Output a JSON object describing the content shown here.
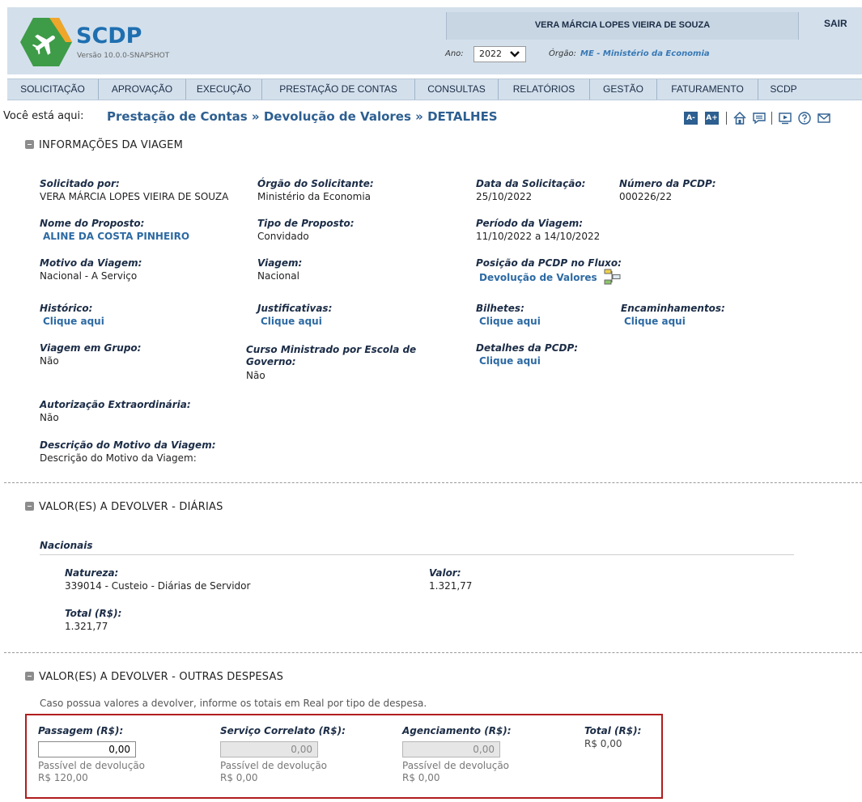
{
  "header": {
    "brand": "SCDP",
    "version": "Versão 10.0.0-SNAPSHOT",
    "user_name": "VERA MÁRCIA LOPES VIEIRA DE SOUZA",
    "logout_label": "SAIR",
    "ano_label": "Ano:",
    "ano_value": "2022",
    "orgao_label": "Órgão:",
    "orgao_value": "ME - Ministério da Economia"
  },
  "nav": {
    "items": [
      {
        "label": "SOLICITAÇÃO"
      },
      {
        "label": "APROVAÇÃO"
      },
      {
        "label": "EXECUÇÃO"
      },
      {
        "label": "PRESTAÇÃO DE CONTAS"
      },
      {
        "label": "CONSULTAS"
      },
      {
        "label": "RELATÓRIOS"
      },
      {
        "label": "GESTÃO"
      },
      {
        "label": "FATURAMENTO"
      },
      {
        "label": "SCDP"
      }
    ]
  },
  "breadcrumb": {
    "label": "Você está aqui:",
    "part1": "Prestação de Contas",
    "part2": "Devolução de Valores",
    "part3": "DETALHES",
    "separator": "»"
  },
  "tools": {
    "decrease_font": "A-",
    "increase_font": "A+"
  },
  "viagem": {
    "title": "INFORMAÇÕES DA VIAGEM",
    "solicitado_por_label": "Solicitado por:",
    "solicitado_por_value": "VERA MÁRCIA LOPES VIEIRA DE SOUZA",
    "orgao_solicitante_label": "Órgão do Solicitante:",
    "orgao_solicitante_value": "Ministério da Economia",
    "data_solicitacao_label": "Data da Solicitação:",
    "data_solicitacao_value": "25/10/2022",
    "numero_pcdp_label": "Número da PCDP:",
    "numero_pcdp_value": "000226/22",
    "nome_proposto_label": "Nome do Proposto:",
    "nome_proposto_value": "ALINE DA COSTA PINHEIRO",
    "tipo_proposto_label": "Tipo de Proposto:",
    "tipo_proposto_value": "Convidado",
    "periodo_label": "Período da Viagem:",
    "periodo_value": "11/10/2022 a 14/10/2022",
    "motivo_label": "Motivo da Viagem:",
    "motivo_value": "Nacional - A Serviço",
    "viagem_label": "Viagem:",
    "viagem_value": "Nacional",
    "posicao_label": "Posição da PCDP no Fluxo:",
    "posicao_value": "Devolução de Valores",
    "historico_label": "Histórico:",
    "historico_link": "Clique aqui",
    "justificativas_label": "Justificativas:",
    "justificativas_link": "Clique aqui",
    "bilhetes_label": "Bilhetes:",
    "bilhetes_link": "Clique aqui",
    "encaminhamentos_label": "Encaminhamentos:",
    "encaminhamentos_link": "Clique aqui",
    "grupo_label": "Viagem em Grupo:",
    "grupo_value": "Não",
    "curso_label": "Curso Ministrado por Escola de Governo:",
    "curso_value": "Não",
    "detalhes_label": "Detalhes da PCDP:",
    "detalhes_link": "Clique aqui",
    "autorizacao_label": "Autorização Extraordinária:",
    "autorizacao_value": "Não",
    "descricao_label": "Descrição do Motivo da Viagem:",
    "descricao_value": "Descrição do Motivo da Viagem:"
  },
  "diarias": {
    "title": "VALOR(ES) A DEVOLVER - DIÁRIAS",
    "subtitle": "Nacionais",
    "natureza_label": "Natureza:",
    "natureza_value": "339014 - Custeio - Diárias de Servidor",
    "valor_label": "Valor:",
    "valor_value": "1.321,77",
    "total_label": "Total (R$):",
    "total_value": "1.321,77"
  },
  "outras": {
    "title": "VALOR(ES) A DEVOLVER - OUTRAS DESPESAS",
    "instructions": "Caso possua valores a devolver, informe os totais em Real por tipo de despesa.",
    "passagem_label": "Passagem (R$):",
    "passagem_value": "0,00",
    "passagem_passivel": "Passível de devolução",
    "passagem_passivel_value": "R$ 120,00",
    "servico_label": "Serviço Correlato (R$):",
    "servico_value": "0,00",
    "servico_passivel": "Passível de devolução",
    "servico_passivel_value": "R$ 0,00",
    "agenciamento_label": "Agenciamento (R$):",
    "agenciamento_value": "0,00",
    "agenciamento_passivel": "Passível de devolução",
    "agenciamento_passivel_value": "R$ 0,00",
    "total_label": "Total (R$):",
    "total_value": "R$ 0,00"
  },
  "colors": {
    "header_bg": "#d3e0ec",
    "link": "#2d6aa3",
    "highlight_border": "#b01d1d"
  }
}
